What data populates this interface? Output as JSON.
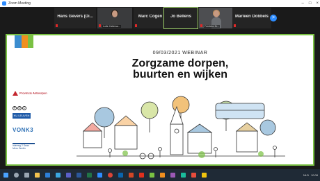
{
  "window": {
    "title": "Zoom Meeting",
    "controls": [
      "–",
      "□",
      "×"
    ]
  },
  "gallery": {
    "participants": [
      {
        "name": "Hans Gevers (Di...",
        "video": false,
        "muted": true
      },
      {
        "name": "",
        "video": true,
        "label": "Lotte Cattersa...",
        "muted": true
      },
      {
        "name": "Marc Cogen",
        "video": false,
        "muted": true
      },
      {
        "name": "Jo Bellens",
        "video": false,
        "active": true
      },
      {
        "name": "",
        "video": true,
        "label": "Fredieke Dr...",
        "muted": true
      },
      {
        "name": "Marleen Dobbels",
        "video": false,
        "muted": true
      }
    ],
    "next_page_icon": ">"
  },
  "slide": {
    "date": "09/03/2021 WEBINAR",
    "title_line1": "Zorgzame dorpen,",
    "title_line2": "buurten en wijken",
    "logos": {
      "provincie": "Provincie Antwerpen",
      "pol": [
        "P",
        "O",
        "L"
      ],
      "kul": "KU LEUVEN",
      "vonk": "VONK3",
      "interreg": "interreg 2 Seas Mers Zeeën"
    },
    "brand_colors": {
      "blue": "#3c8dcf",
      "orange": "#f08f1f",
      "green": "#7ac143"
    }
  },
  "taskbar": {
    "apps": [
      "start-icon",
      "search-icon",
      "taskview-icon",
      "explorer-icon",
      "mail-icon",
      "browser-icon",
      "teams-icon",
      "word-icon",
      "excel-icon",
      "zoom-icon",
      "chrome-icon",
      "outlook-icon",
      "powerpoint-icon",
      "pdf-icon",
      "app-icon",
      "app-icon",
      "app-icon",
      "app-icon",
      "app-icon",
      "app-icon"
    ],
    "tray_time": "10:08",
    "tray_lang": "NLD"
  },
  "accent": {
    "active_speaker": "#9ed36a",
    "zoom_blue": "#2d8cff",
    "mute_red": "#e02828"
  }
}
